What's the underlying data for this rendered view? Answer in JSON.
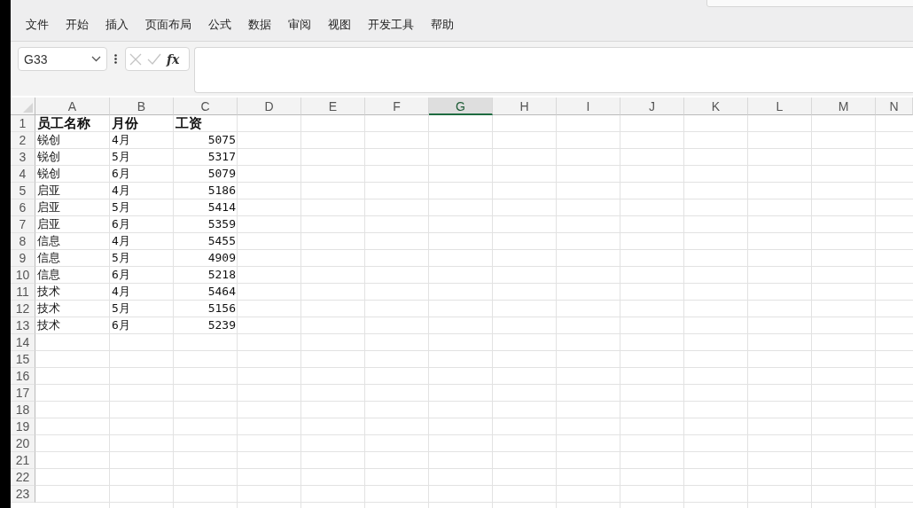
{
  "ribbon_tabs": [
    {
      "label": "文件"
    },
    {
      "label": "开始"
    },
    {
      "label": "插入"
    },
    {
      "label": "页面布局"
    },
    {
      "label": "公式"
    },
    {
      "label": "数据"
    },
    {
      "label": "审阅"
    },
    {
      "label": "视图"
    },
    {
      "label": "开发工具"
    },
    {
      "label": "帮助"
    }
  ],
  "formula_bar": {
    "name_box": "G33",
    "fx": "fx"
  },
  "columns": [
    {
      "label": "A",
      "selected": false
    },
    {
      "label": "B",
      "selected": false
    },
    {
      "label": "C",
      "selected": false
    },
    {
      "label": "D",
      "selected": false
    },
    {
      "label": "E",
      "selected": false
    },
    {
      "label": "F",
      "selected": false
    },
    {
      "label": "G",
      "selected": true
    },
    {
      "label": "H",
      "selected": false
    },
    {
      "label": "I",
      "selected": false
    },
    {
      "label": "J",
      "selected": false
    },
    {
      "label": "K",
      "selected": false
    },
    {
      "label": "L",
      "selected": false
    },
    {
      "label": "M",
      "selected": false
    },
    {
      "label": "N",
      "selected": false
    }
  ],
  "rows": [
    {
      "number": "1",
      "kind": "header",
      "cells": [
        "员工名称",
        "月份",
        "工资"
      ]
    },
    {
      "number": "2",
      "kind": "data",
      "cells": [
        "锐创",
        "4月",
        "5075"
      ]
    },
    {
      "number": "3",
      "kind": "data",
      "cells": [
        "锐创",
        "5月",
        "5317"
      ]
    },
    {
      "number": "4",
      "kind": "data",
      "cells": [
        "锐创",
        "6月",
        "5079"
      ]
    },
    {
      "number": "5",
      "kind": "data",
      "cells": [
        "启亚",
        "4月",
        "5186"
      ]
    },
    {
      "number": "6",
      "kind": "data",
      "cells": [
        "启亚",
        "5月",
        "5414"
      ]
    },
    {
      "number": "7",
      "kind": "data",
      "cells": [
        "启亚",
        "6月",
        "5359"
      ]
    },
    {
      "number": "8",
      "kind": "data",
      "cells": [
        "信息",
        "4月",
        "5455"
      ]
    },
    {
      "number": "9",
      "kind": "data",
      "cells": [
        "信息",
        "5月",
        "4909"
      ]
    },
    {
      "number": "10",
      "kind": "data",
      "cells": [
        "信息",
        "6月",
        "5218"
      ]
    },
    {
      "number": "11",
      "kind": "data",
      "cells": [
        "技术",
        "4月",
        "5464"
      ]
    },
    {
      "number": "12",
      "kind": "data",
      "cells": [
        "技术",
        "5月",
        "5156"
      ]
    },
    {
      "number": "13",
      "kind": "data",
      "cells": [
        "技术",
        "6月",
        "5239"
      ]
    },
    {
      "number": "14"
    },
    {
      "number": "15"
    },
    {
      "number": "16"
    },
    {
      "number": "17"
    },
    {
      "number": "18"
    },
    {
      "number": "19"
    },
    {
      "number": "20"
    },
    {
      "number": "21"
    },
    {
      "number": "22"
    },
    {
      "number": "23"
    }
  ]
}
